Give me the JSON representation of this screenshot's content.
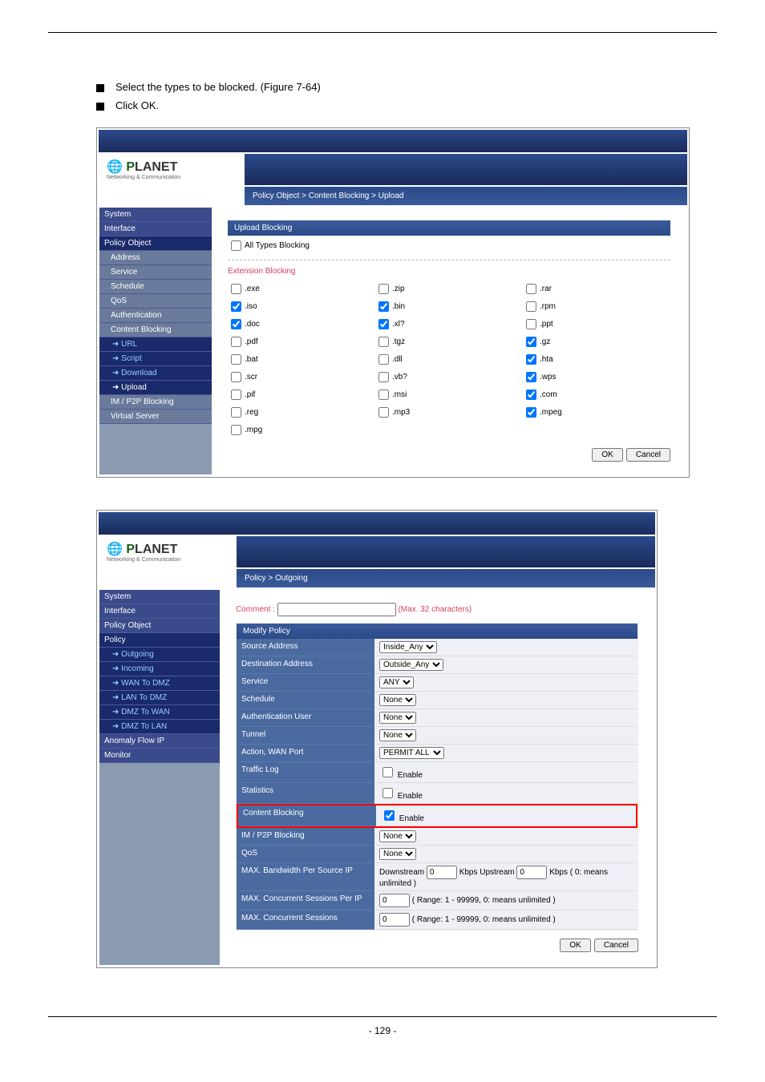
{
  "steps": {
    "s1": "Select the types to be blocked. (Figure 7-64)",
    "s2": "Click OK."
  },
  "bc1": "Policy Object > Content Blocking > Upload",
  "nav": {
    "system": "System",
    "interface": "Interface",
    "policyobj": "Policy Object",
    "address": "Address",
    "service": "Service",
    "schedule": "Schedule",
    "qos": "QoS",
    "auth": "Authentication",
    "cblock": "Content Blocking",
    "url": "URL",
    "script": "Script",
    "download": "Download",
    "upload": "Upload",
    "im": "IM / P2P Blocking",
    "vs": "Virtual Server"
  },
  "ub": {
    "title": "Upload Blocking",
    "all": "All Types Blocking",
    "ext": "Extension Blocking",
    "exe": ".exe",
    "zip": ".zip",
    "rar": ".rar",
    "iso": ".iso",
    "bin": ".bin",
    "rpm": ".rpm",
    "doc": ".doc",
    "xl": ".xl?",
    "ppt": ".ppt",
    "pdf": ".pdf",
    "tgz": ".tgz",
    "gz": ".gz",
    "bat": ".bat",
    "dll": ".dll",
    "hta": ".hta",
    "scr": ".scr",
    "vb": ".vb?",
    "wps": ".wps",
    "pif": ".pif",
    "msi": ".msi",
    "com": ".com",
    "reg": ".reg",
    "mp3": ".mp3",
    "mpeg": ".mpeg",
    "mpg": ".mpg"
  },
  "ok": "OK",
  "cancel": "Cancel",
  "bc2": "Policy > Outgoing",
  "nav2": {
    "system": "System",
    "interface": "Interface",
    "policyobj": "Policy Object",
    "policy": "Policy",
    "outgoing": "Outgoing",
    "incoming": "Incoming",
    "wtd": "WAN To DMZ",
    "ltd": "LAN To DMZ",
    "dtw": "DMZ To WAN",
    "dtl": "DMZ To LAN",
    "anom": "Anomaly Flow IP",
    "mon": "Monitor"
  },
  "pf": {
    "comment": "Comment :",
    "max32": "(Max. 32 characters)",
    "title": "Modify Policy",
    "src": "Source Address",
    "srcv": "Inside_Any",
    "dst": "Destination Address",
    "dstv": "Outside_Any",
    "svc": "Service",
    "svcv": "ANY",
    "sch": "Schedule",
    "schv": "None",
    "au": "Authentication User",
    "auv": "None",
    "tun": "Tunnel",
    "tunv": "None",
    "act": "Action, WAN Port",
    "actv": "PERMIT ALL",
    "tlog": "Traffic Log",
    "stat": "Statistics",
    "cb": "Content Blocking",
    "im": "IM / P2P Blocking",
    "imv": "None",
    "qos": "QoS",
    "qosv": "None",
    "bw": "MAX. Bandwidth Per Source IP",
    "ds": "Downstream",
    "us": "Kbps Upstream",
    "kbu": "Kbps ( 0: means unlimited )",
    "cs": "MAX. Concurrent Sessions Per IP",
    "mcs": "MAX. Concurrent Sessions",
    "rng": "( Range: 1 - 99999, 0: means unlimited )",
    "en": "Enable"
  },
  "pg": "- 129 -"
}
